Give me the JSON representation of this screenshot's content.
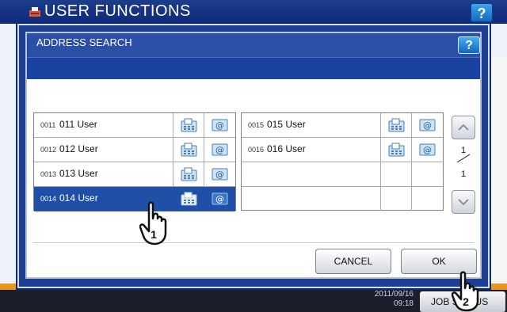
{
  "background": {
    "title": "USER FUNCTIONS",
    "help_label": "?",
    "clock_date": "2011/09/16",
    "clock_time": "09:18",
    "job_status_label": "JOB STATUS"
  },
  "dialog": {
    "title": "ADDRESS SEARCH",
    "help_label": "?",
    "left_entries": [
      {
        "number": "0011",
        "name": "011 User",
        "selected": false
      },
      {
        "number": "0012",
        "name": "012 User",
        "selected": false
      },
      {
        "number": "0013",
        "name": "013 User",
        "selected": false
      },
      {
        "number": "0014",
        "name": "014 User",
        "selected": true
      }
    ],
    "right_entries": [
      {
        "number": "0015",
        "name": "015 User"
      },
      {
        "number": "0016",
        "name": "016 User"
      },
      {
        "number": "",
        "name": ""
      },
      {
        "number": "",
        "name": ""
      }
    ],
    "page_current": "1",
    "page_total": "1",
    "cancel_label": "CANCEL",
    "ok_label": "OK"
  },
  "callouts": [
    "1",
    "2"
  ],
  "colors": {
    "titlebar": "#11297a",
    "dialog_frame": "#1d3f92",
    "selection": "#1f4fa6",
    "help_button": "#1069c4"
  },
  "icons": {
    "fax": "fax-icon",
    "email": "email-icon",
    "scroll_up": "chevron-up-icon",
    "scroll_down": "chevron-down-icon",
    "pointer": "hand-pointer-icon"
  }
}
